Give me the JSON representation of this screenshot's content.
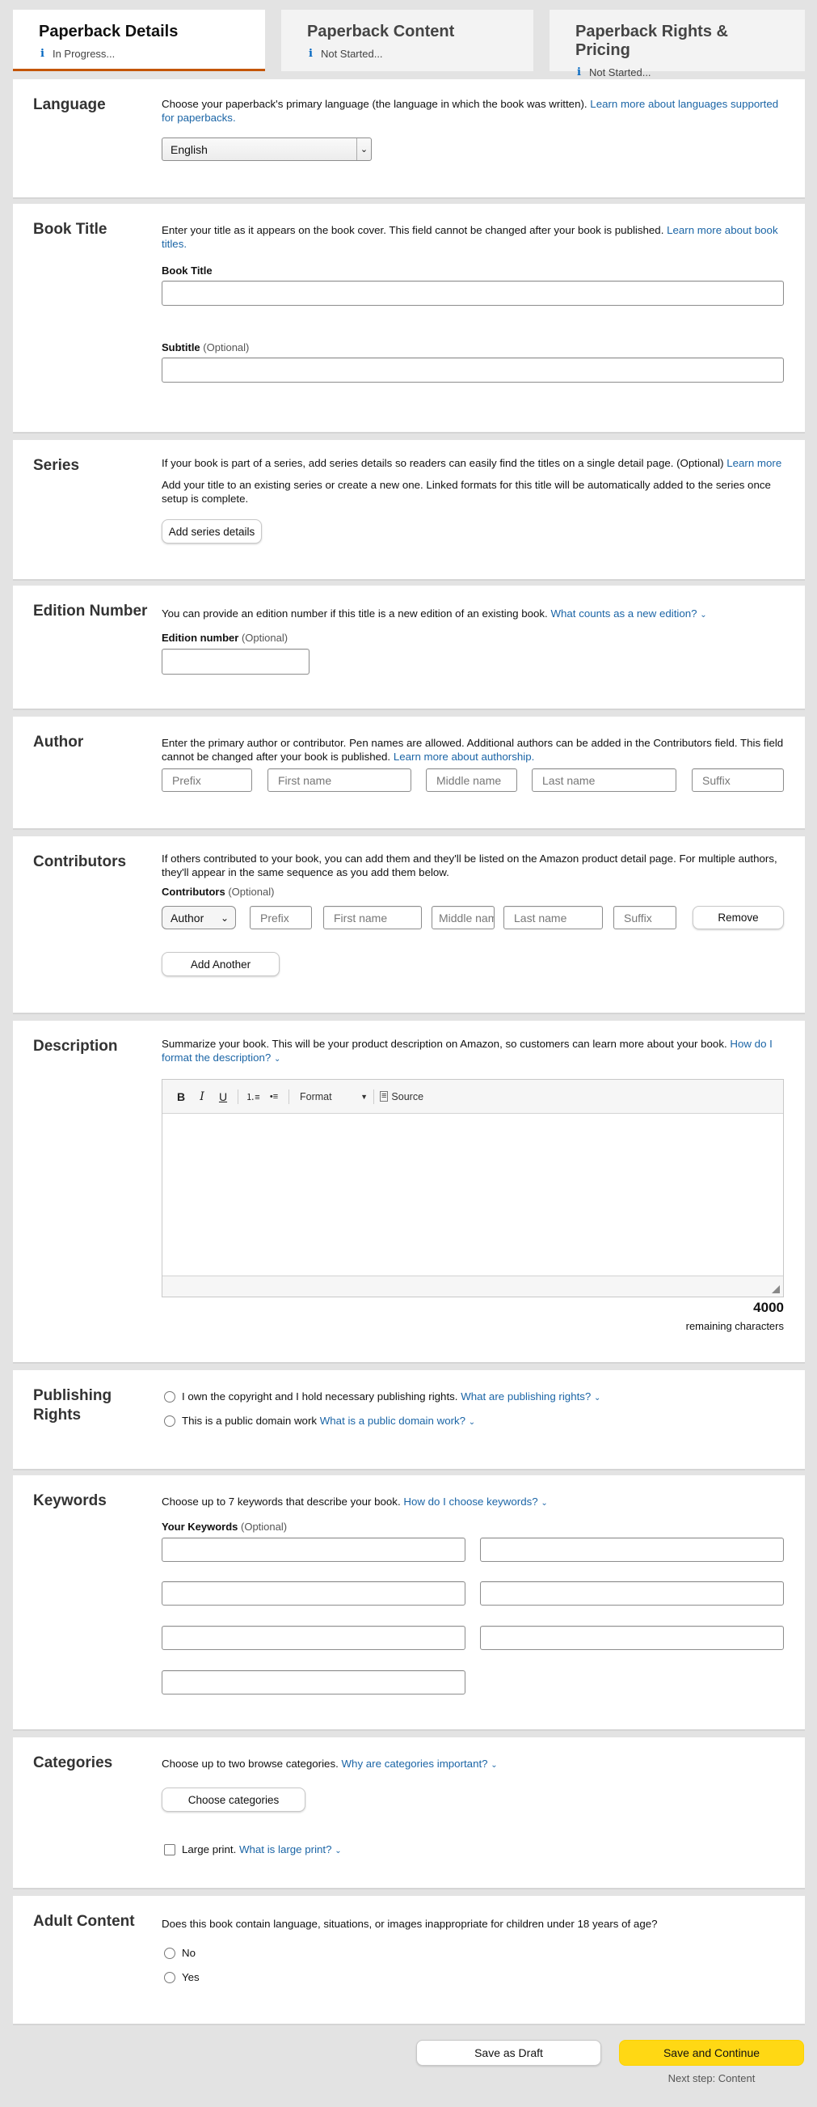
{
  "tabs": [
    {
      "title": "Paperback Details",
      "status": "In Progress..."
    },
    {
      "title": "Paperback Content",
      "status": "Not Started..."
    },
    {
      "title": "Paperback Rights & Pricing",
      "status": "Not Started..."
    }
  ],
  "language": {
    "title": "Language",
    "desc": "Choose your paperback's primary language (the language in which the book was written).",
    "link": "Learn more about languages supported for paperbacks.",
    "selected": "English"
  },
  "book_title": {
    "title": "Book Title",
    "desc": "Enter your title as it appears on the book cover. This field cannot be changed after your book is published.",
    "link": "Learn more about book titles.",
    "title_label": "Book Title",
    "subtitle_label": "Subtitle",
    "optional": "(Optional)"
  },
  "series": {
    "title": "Series",
    "desc1": "If your book is part of a series, add series details so readers can easily find the titles on a single detail page. (Optional)",
    "link": "Learn more",
    "desc2": "Add your title to an existing series or create a new one. Linked formats for this title will be automatically added to the series once setup is complete.",
    "button": "Add series details"
  },
  "edition": {
    "title": "Edition Number",
    "desc": "You can provide an edition number if this title is a new edition of an existing book.",
    "link": "What counts as a new edition?",
    "label": "Edition number",
    "optional": "(Optional)"
  },
  "author": {
    "title": "Author",
    "desc": "Enter the primary author or contributor. Pen names are allowed. Additional authors can be added in the Contributors field. This field cannot be changed after your book is published.",
    "link": "Learn more about authorship.",
    "placeholders": {
      "prefix": "Prefix",
      "first": "First name",
      "middle": "Middle name",
      "last": "Last name",
      "suffix": "Suffix"
    }
  },
  "contributors": {
    "title": "Contributors",
    "desc": "If others contributed to your book, you can add them and they'll be listed on the Amazon product detail page. For multiple authors, they'll appear in the same sequence as you add them below.",
    "label": "Contributors",
    "optional": "(Optional)",
    "role": "Author",
    "placeholders": {
      "prefix": "Prefix",
      "first": "First name",
      "middle": "Middle name",
      "last": "Last name",
      "suffix": "Suffix"
    },
    "remove": "Remove",
    "add_another": "Add Another"
  },
  "description": {
    "title": "Description",
    "desc": "Summarize your book. This will be your product description on Amazon, so customers can learn more about your book.",
    "link": "How do I format the description?",
    "toolbar": {
      "bold": "B",
      "italic": "I",
      "underline": "U",
      "format": "Format",
      "source": "Source"
    },
    "remaining_count": "4000",
    "remaining_label": "remaining characters"
  },
  "rights": {
    "title": "Publishing Rights",
    "option1": "I own the copyright and I hold necessary publishing rights.",
    "link1": "What are publishing rights?",
    "option2": "This is a public domain work",
    "link2": "What is a public domain work?"
  },
  "keywords": {
    "title": "Keywords",
    "desc": "Choose up to 7 keywords that describe your book.",
    "link": "How do I choose keywords?",
    "label": "Your Keywords",
    "optional": "(Optional)"
  },
  "categories": {
    "title": "Categories",
    "desc": "Choose up to two browse categories.",
    "link": "Why are categories important?",
    "button": "Choose categories",
    "large_print": "Large print.",
    "large_print_link": "What is large print?"
  },
  "adult": {
    "title": "Adult Content",
    "desc": "Does this book contain language, situations, or images inappropriate for children under 18 years of age?",
    "no": "No",
    "yes": "Yes"
  },
  "footer": {
    "save_draft": "Save as Draft",
    "save_continue": "Save and Continue",
    "next_step": "Next step: Content"
  },
  "colors": {
    "accent": "#c45500",
    "link": "#1b65a6",
    "primary_button": "#ffd814"
  }
}
